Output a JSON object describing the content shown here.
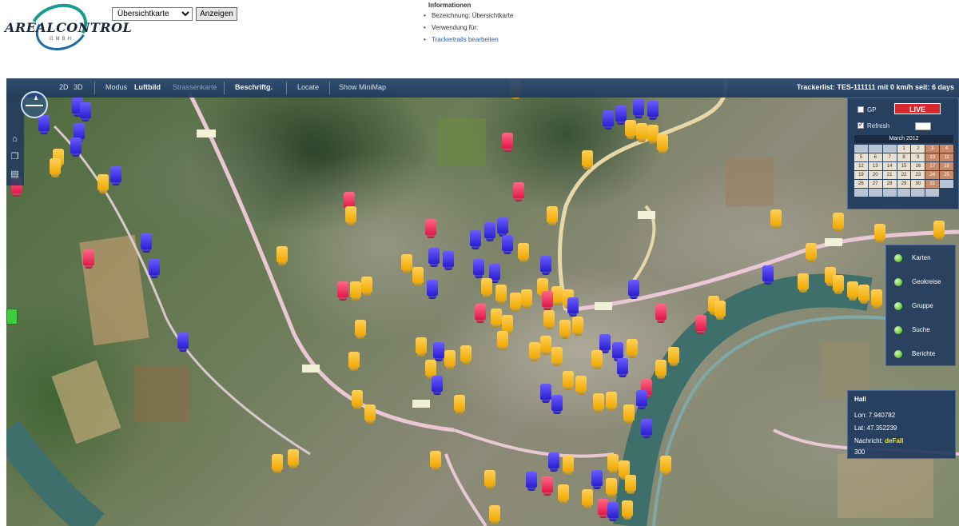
{
  "header": {
    "logo_text": "AREALCONTROL",
    "logo_sub": "GMBH",
    "map_select_value": "Übersichtkarte",
    "show_button_label": "Anzeigen",
    "info": {
      "title": "Informationen",
      "items": [
        "Bezeichnung: Übersichtkarte",
        "Verwendung für:",
        "Trackertrails bearbeiten"
      ]
    }
  },
  "toolbar": {
    "items": [
      {
        "label": "2D",
        "state": "normal"
      },
      {
        "label": "3D",
        "state": "normal"
      },
      {
        "label": "Modus",
        "state": "normal"
      },
      {
        "label": "Luftbild",
        "state": "active"
      },
      {
        "label": "Strassenkarte",
        "state": "dim"
      },
      {
        "label": "Beschriftg.",
        "state": "active"
      },
      {
        "label": "Locate",
        "state": "normal"
      },
      {
        "label": "Show MiniMap",
        "state": "normal"
      }
    ],
    "status": "Trackerlist: TES-111111 mit 0 km/h seit: 6 days"
  },
  "live_panel": {
    "gps_label": "GP",
    "live_label": "LIVE",
    "refresh_label": "Refresh",
    "calendar_header": "March 2012",
    "calendar_days": [
      "",
      "",
      "",
      "1",
      "2",
      "3",
      "4",
      "5",
      "6",
      "7",
      "8",
      "9",
      "10",
      "11",
      "12",
      "13",
      "14",
      "15",
      "16",
      "17",
      "18",
      "19",
      "20",
      "21",
      "22",
      "23",
      "24",
      "25",
      "26",
      "27",
      "28",
      "29",
      "30",
      "31",
      "",
      "",
      "",
      "",
      "",
      "",
      ""
    ]
  },
  "side_menu": {
    "items": [
      "Karten",
      "Geokreise",
      "Gruppe",
      "Suche",
      "Berichte"
    ]
  },
  "info_popup": {
    "title": "Hall",
    "lon": "Lon: 7.940782",
    "lat": "Lat: 47.352239",
    "msg_label": "Nachricht:",
    "msg_value": "deFall",
    "extra": "300"
  },
  "colors": {
    "toolbar": "#203a5e",
    "marker_yellow": "#f0a800",
    "marker_blue": "#2a1fd1",
    "marker_red": "#e0174a",
    "live_red": "#d9272e"
  }
}
